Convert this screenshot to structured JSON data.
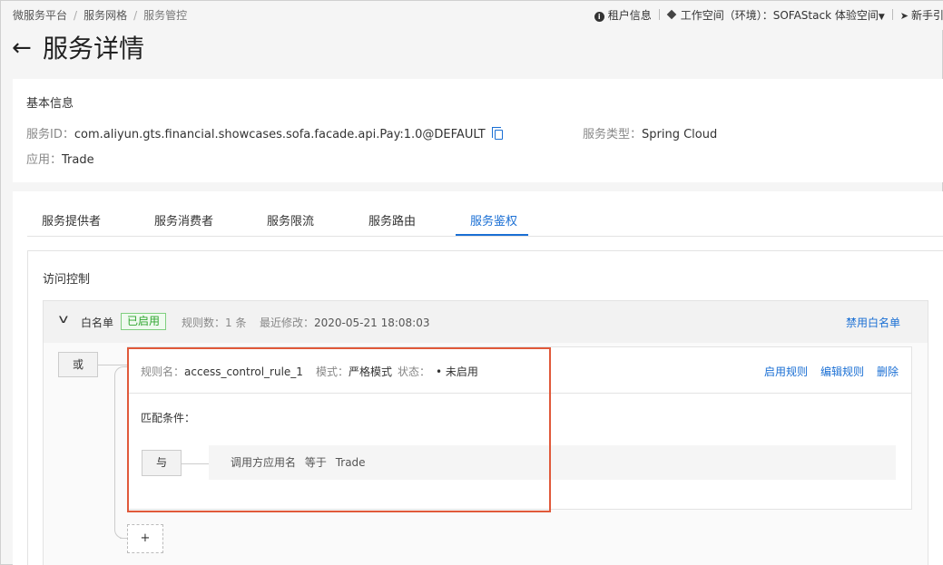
{
  "breadcrumb": {
    "items": [
      "微服务平台",
      "服务网格",
      "服务管控"
    ]
  },
  "topright": {
    "tenant": "租户信息",
    "workspace": "工作空间（环境）：SOFAStack 体验空间",
    "guide": "新手引"
  },
  "page": {
    "back_icon": "←",
    "title": "服务详情"
  },
  "basic": {
    "heading": "基本信息",
    "service_id_label": "服务ID：",
    "service_id": "com.aliyun.gts.financial.showcases.sofa.facade.api.Pay:1.0@DEFAULT",
    "app_label": "应用：",
    "app": "Trade",
    "type_label": "服务类型：",
    "type": "Spring Cloud"
  },
  "tabs": [
    "服务提供者",
    "服务消费者",
    "服务限流",
    "服务路由",
    "服务鉴权"
  ],
  "active_tab": "服务鉴权",
  "access": {
    "title": "访问控制",
    "whitelist": {
      "label": "白名单",
      "status": "已启用",
      "rule_count": "规则数：1 条",
      "modified_label": "最近修改：",
      "modified": "2020-05-21 18:08:03",
      "disable_link": "禁用白名单"
    },
    "or_label": "或",
    "rule": {
      "name_label": "规则名：",
      "name": "access_control_rule_1",
      "mode_label": "模式：",
      "mode": "严格模式",
      "status_label": "状态：",
      "status": "• 未启用",
      "enable": "启用规则",
      "edit": "编辑规则",
      "delete": "删除",
      "match_label": "匹配条件：",
      "and_label": "与",
      "condition": {
        "field": "调用方应用名",
        "op": "等于",
        "value": "Trade"
      }
    },
    "add_label": "+"
  },
  "colors": {
    "accent": "#1a6fd4",
    "success": "#2fa52f",
    "highlight": "#e0593a"
  }
}
